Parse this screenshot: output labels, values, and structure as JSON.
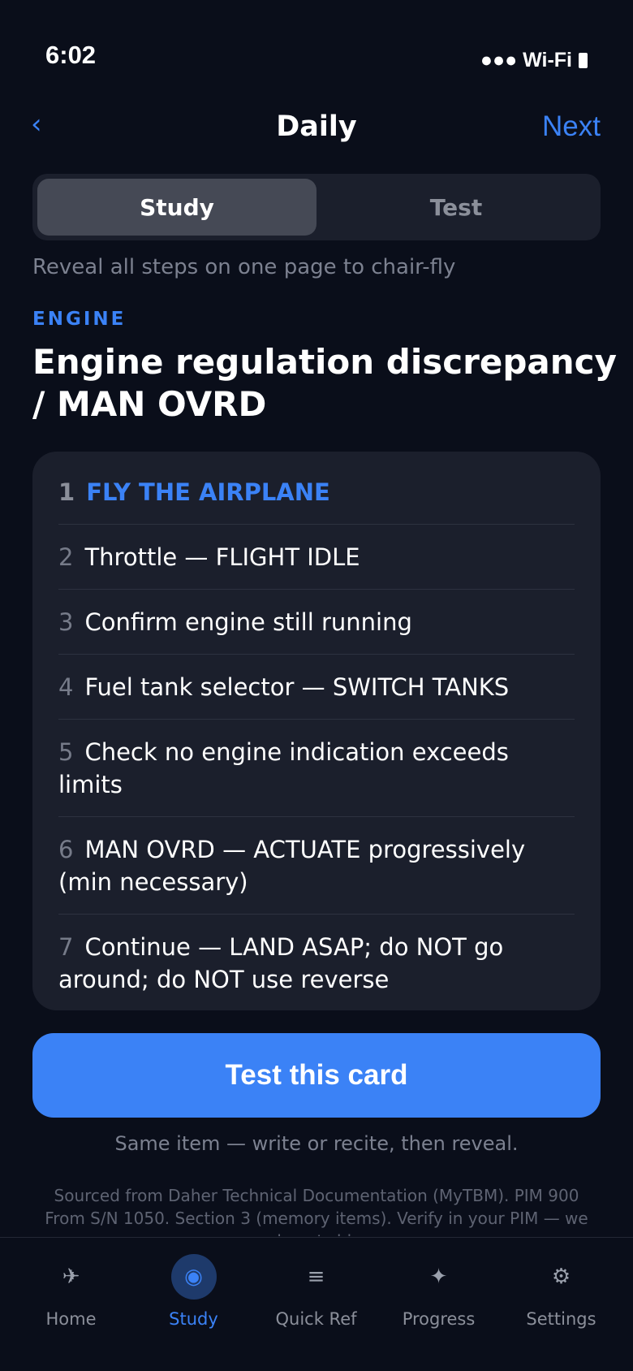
{
  "status": {
    "time": "6:02",
    "signal": "●●● Wi-Fi"
  },
  "nav": {
    "back_icon": "‹",
    "title": "Daily",
    "next_label": "Next"
  },
  "mode": {
    "study_label": "Study",
    "test_label": "Test",
    "selected": "Study"
  },
  "subtitle": "Reveal all steps on one page to chair-fly",
  "card": {
    "category": "ENGINE",
    "title": "Engine regulation discrepancy / MAN OVRD",
    "steps": [
      {
        "num": "1",
        "text": "FLY THE AIRPLANE"
      },
      {
        "num": "2",
        "text": "Throttle — FLIGHT IDLE"
      },
      {
        "num": "3",
        "text": "Confirm engine still running"
      },
      {
        "num": "4",
        "text": "Fuel tank selector — SWITCH TANKS"
      },
      {
        "num": "5",
        "text": "Check no engine indication exceeds limits"
      },
      {
        "num": "6",
        "text": "MAN OVRD — ACTUATE progressively (min necessary)"
      },
      {
        "num": "7",
        "text": "Continue — LAND ASAP; do NOT go around; do NOT use reverse"
      }
    ]
  },
  "cta": {
    "label": "Test this card",
    "hint": "Same item — write or recite, then reveal."
  },
  "source_note": "Sourced from Daher Technical Documentation (MyTBM). PIM 900 From S/N 1050. Section 3 (memory items). Verify in your PIM — we do not ship",
  "tabbar": {
    "items": [
      {
        "label": "Home",
        "icon": "✈",
        "icon_name": "airplane-icon"
      },
      {
        "label": "Study",
        "icon": "◉",
        "icon_name": "study-icon"
      },
      {
        "label": "Quick Ref",
        "icon": "≡",
        "icon_name": "list-icon"
      },
      {
        "label": "Progress",
        "icon": "✦",
        "icon_name": "sparkle-icon"
      },
      {
        "label": "Settings",
        "icon": "⚙",
        "icon_name": "gear-icon"
      }
    ],
    "active": "Study"
  },
  "colors": {
    "accent": "#3b82f6",
    "background": "#0a0e1a",
    "card": "#1b1f2c"
  }
}
